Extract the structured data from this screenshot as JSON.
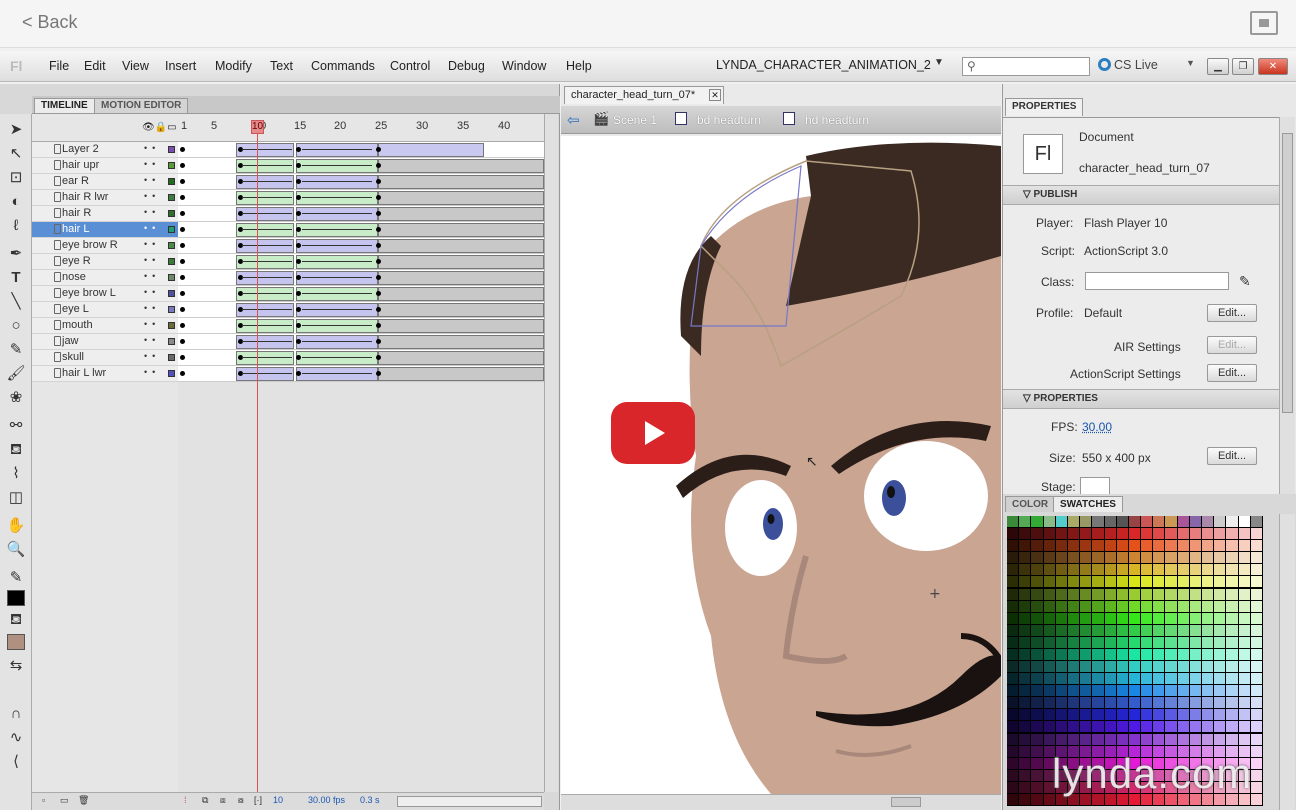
{
  "player": {
    "back_label": "< Back"
  },
  "menubar": {
    "logo": "Fl",
    "items": [
      "File",
      "Edit",
      "View",
      "Insert",
      "Modify",
      "Text",
      "Commands",
      "Control",
      "Debug",
      "Window",
      "Help"
    ],
    "workspace": "LYNDA_CHARACTER_ANIMATION_2",
    "cs_live": "CS Live",
    "search_placeholder": ""
  },
  "panels": {
    "timeline_tab": "TIMELINE",
    "motion_tab": "MOTION EDITOR"
  },
  "timeline": {
    "frame_numbers": [
      "1",
      "5",
      "10",
      "15",
      "20",
      "25",
      "30",
      "35",
      "40"
    ],
    "current_frame": "10",
    "layers": [
      "Layer 2",
      "hair upr",
      "ear R",
      "hair R lwr",
      "hair R",
      "hair L",
      "eye brow R",
      "eye R",
      "nose",
      "eye brow L",
      "eye L",
      "mouth",
      "jaw",
      "skull",
      "hair L lwr"
    ],
    "selected_layer": "hair L",
    "status_frame": "10",
    "status_fps": "30.00 fps",
    "status_time": "0.3 s"
  },
  "stage": {
    "doc_tab": "character_head_turn_07*",
    "breadcrumbs": [
      "Scene 1",
      "bd headturn",
      "hd headturn"
    ]
  },
  "properties": {
    "tab": "PROPERTIES",
    "doc_label": "Document",
    "doc_name": "character_head_turn_07",
    "doc_icon": "Fl",
    "publish_section": "PUBLISH",
    "player_label": "Player:",
    "player_value": "Flash Player 10",
    "script_label": "Script:",
    "script_value": "ActionScript 3.0",
    "class_label": "Class:",
    "profile_label": "Profile:",
    "profile_value": "Default",
    "edit_label": "Edit...",
    "air_settings": "AIR Settings",
    "as_settings": "ActionScript Settings",
    "props_section": "PROPERTIES",
    "fps_label": "FPS:",
    "fps_value": "30.00",
    "size_label": "Size:",
    "size_value": "550 x 400 px",
    "stage_label": "Stage:"
  },
  "swatches": {
    "color_tab": "COLOR",
    "swatches_tab": "SWATCHES"
  },
  "watermark": "lynda.com",
  "colors": {
    "accent": "#5a8fd6",
    "playhead": "#e05050",
    "youtube": "#d8262b",
    "hair": "#3a2a22",
    "skin": "#c9a592",
    "eye_iris": "#3b4f9b"
  }
}
